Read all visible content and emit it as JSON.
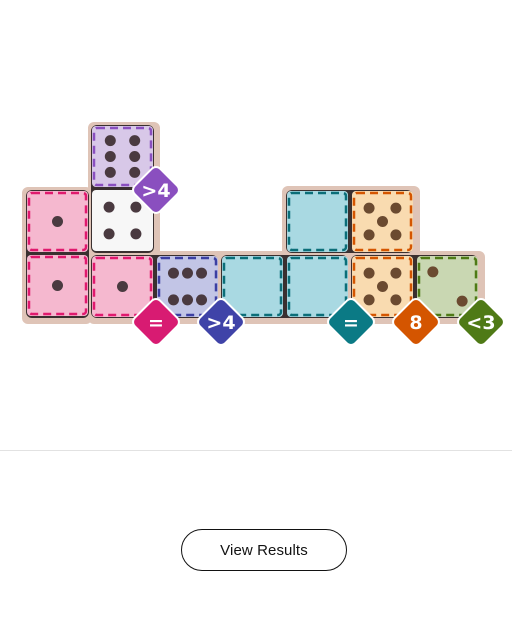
{
  "game": {
    "cells": [
      {
        "id": "c1",
        "pips": 6,
        "color": "#d8c8e8",
        "dash": "#8a4fbf",
        "region": "purple"
      },
      {
        "id": "c2",
        "pips": 4,
        "color": "#f7f7f7",
        "dash": null,
        "region": "none"
      },
      {
        "id": "c3",
        "pips": 1,
        "color": "#f5b8cf",
        "dash": "#e0196e",
        "region": "pink"
      },
      {
        "id": "c4",
        "pips": 1,
        "color": "#f5b8cf",
        "dash": "#e0196e",
        "region": "pink"
      },
      {
        "id": "c5",
        "pips": 1,
        "color": "#f5b8cf",
        "dash": "#e0196e",
        "region": "pink"
      },
      {
        "id": "c6",
        "pips": 6,
        "color": "#c2c5e6",
        "dash": "#3c3fa2",
        "region": "indigo"
      },
      {
        "id": "c7",
        "pips": 0,
        "color": "#a9d9e2",
        "dash": "#0b6e78",
        "region": "teal"
      },
      {
        "id": "c8",
        "pips": 0,
        "color": "#a9d9e2",
        "dash": "#0b6e78",
        "region": "teal"
      },
      {
        "id": "c9",
        "pips": 0,
        "color": "#a9d9e2",
        "dash": "#0b6e78",
        "region": "teal"
      },
      {
        "id": "c10",
        "pips": 5,
        "color": "#f9dbb0",
        "dash": "#d45500",
        "region": "orange"
      },
      {
        "id": "c11",
        "pips": 5,
        "color": "#f9dbb0",
        "dash": "#d45500",
        "region": "orange"
      },
      {
        "id": "c12",
        "pips": 2,
        "color": "#c9d7b2",
        "dash": "#4f7a16",
        "region": "green"
      }
    ],
    "badges": [
      {
        "label": ">4",
        "color": "#8a4fbf",
        "region": "purple"
      },
      {
        "label": "=",
        "color": "#d81b72",
        "region": "pink"
      },
      {
        "label": ">4",
        "color": "#3f43a8",
        "region": "indigo"
      },
      {
        "label": "=",
        "color": "#0b7a85",
        "region": "teal"
      },
      {
        "label": "8",
        "color": "#d45500",
        "region": "orange"
      },
      {
        "label": "<3",
        "color": "#4f7a16",
        "region": "green"
      }
    ]
  },
  "results_button": {
    "label": "View Results"
  }
}
